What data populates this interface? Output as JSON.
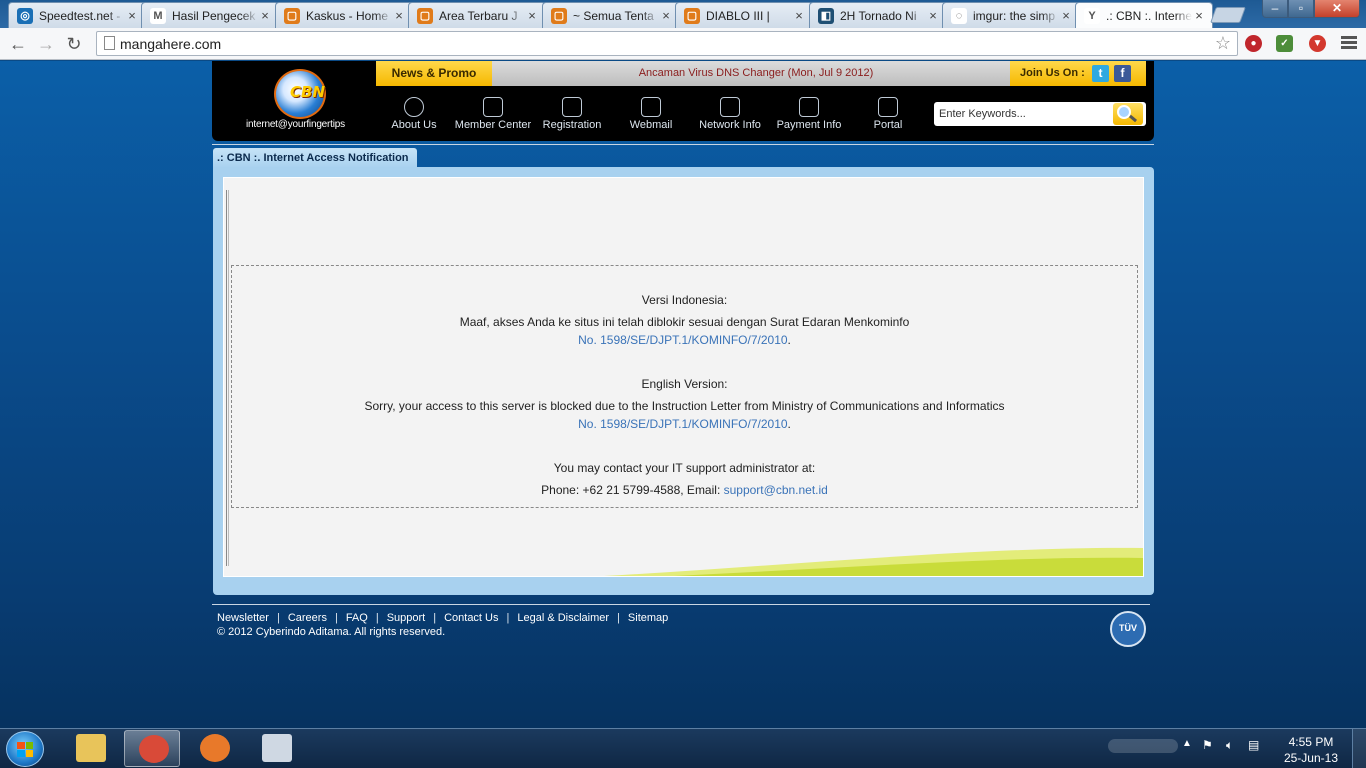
{
  "browser": {
    "tabs": [
      {
        "title": "Speedtest.net -",
        "icon": "speedtest-icon",
        "color": "#1a6fb5",
        "glyph": "◎"
      },
      {
        "title": "Hasil Pengecek",
        "icon": "gmail-icon",
        "color": "#ffffff",
        "glyph": "M"
      },
      {
        "title": "Kaskus - Home",
        "icon": "kaskus-icon",
        "color": "#e07b1a",
        "glyph": "▢"
      },
      {
        "title": "Area Terbaru J",
        "icon": "kaskus-icon",
        "color": "#e07b1a",
        "glyph": "▢"
      },
      {
        "title": "~ Semua Tenta",
        "icon": "kaskus-icon",
        "color": "#e07b1a",
        "glyph": "▢"
      },
      {
        "title": "DIABLO III |",
        "icon": "kaskus-icon",
        "color": "#e07b1a",
        "glyph": "▢"
      },
      {
        "title": "2H Tornado Ni",
        "icon": "site-icon",
        "color": "#1f4f73",
        "glyph": "◧"
      },
      {
        "title": "imgur: the simp",
        "icon": "loading-icon",
        "color": "#ffffff",
        "glyph": "◌"
      },
      {
        "title": ".: CBN :. Interne",
        "icon": "yahoo-icon",
        "color": "#ffffff",
        "glyph": "Y"
      }
    ],
    "active_tab": 8,
    "url": "mangahere.com",
    "window_controls": {
      "minimize": "–",
      "maximize": "▫",
      "close": "✕"
    }
  },
  "site": {
    "logo_text": "CBN",
    "tagline": "internet@yourfingertips",
    "news_label": "News & Promo",
    "news_ticker": "Ancaman Virus DNS Changer (Mon, Jul 9 2012)",
    "join_label": "Join Us On :",
    "social": [
      {
        "name": "twitter-icon",
        "glyph": "t",
        "color": "#2fa9e0"
      },
      {
        "name": "facebook-icon",
        "glyph": "f",
        "color": "#3b5998"
      }
    ],
    "nav": [
      {
        "label": "About Us",
        "icon": "globe-icon"
      },
      {
        "label": "Member Center",
        "icon": "members-icon"
      },
      {
        "label": "Registration",
        "icon": "pencil-icon"
      },
      {
        "label": "Webmail",
        "icon": "mail-icon"
      },
      {
        "label": "Network Info",
        "icon": "chart-icon"
      },
      {
        "label": "Payment Info",
        "icon": "card-icon"
      },
      {
        "label": "Portal",
        "icon": "portal-icon"
      }
    ],
    "search_placeholder": "Enter Keywords...",
    "panel_title": ".: CBN :. Internet Access Notification"
  },
  "notice": {
    "id_heading": "Versi Indonesia:",
    "id_text": "Maaf, akses Anda ke situs ini telah diblokir sesuai dengan Surat Edaran Menkominfo",
    "id_link": "No. 1598/SE/DJPT.1/KOMINFO/7/2010",
    "en_heading": "English Version:",
    "en_text": "Sorry, your access to this server is blocked due to the Instruction Letter from Ministry of Communications and Informatics",
    "en_link": "No. 1598/SE/DJPT.1/KOMINFO/7/2010",
    "contact_text": "You may contact your IT support administrator at:",
    "contact_line_prefix": "Phone: +62 21 5799-4588, Email: ",
    "contact_email": "support@cbn.net.id",
    "period": "."
  },
  "footer": {
    "links": [
      "Newsletter",
      "Careers",
      "FAQ",
      "Support",
      "Contact Us",
      "Legal & Disclaimer",
      "Sitemap"
    ],
    "separator": "|",
    "copyright": "© 2012 Cyberindo Aditama. All rights reserved.",
    "badge": "TÜV"
  },
  "taskbar": {
    "apps": [
      {
        "name": "explorer-icon",
        "color": "#e8c45a"
      },
      {
        "name": "chrome-icon",
        "color": "#d94a38",
        "active": true
      },
      {
        "name": "firefox-icon",
        "color": "#e8792a"
      },
      {
        "name": "window-icon",
        "color": "#cfd8e3"
      }
    ],
    "time": "4:55 PM",
    "date": "25-Jun-13"
  }
}
